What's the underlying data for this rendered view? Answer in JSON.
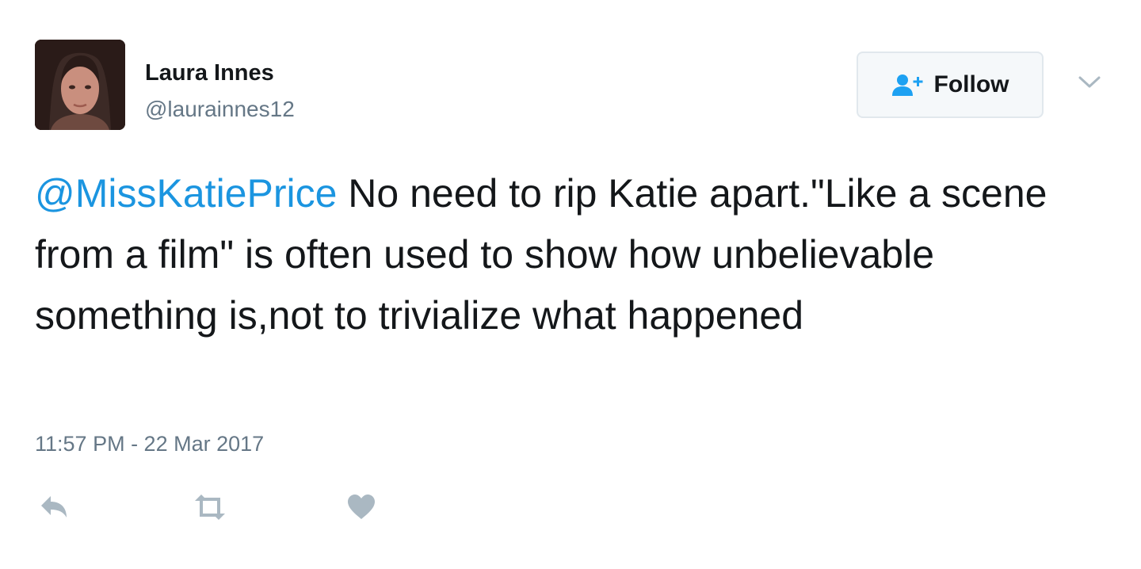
{
  "user": {
    "display_name": "Laura Innes",
    "handle": "@laurainnes12",
    "avatar_icon": "profile-photo"
  },
  "follow_button": {
    "label": "Follow",
    "icon": "add-user-icon"
  },
  "menu": {
    "icon": "chevron-down-icon"
  },
  "tweet": {
    "mention": "@MissKatiePrice",
    "text": " No need to rip Katie apart.\"Like a scene from a film\" is often used to show how unbelievable something is,not to trivialize what happened",
    "timestamp": "11:57 PM - 22 Mar 2017"
  },
  "actions": [
    {
      "icon": "reply-icon"
    },
    {
      "icon": "retweet-icon"
    },
    {
      "icon": "like-icon"
    }
  ],
  "colors": {
    "link": "#1b95e0",
    "secondary_text": "#657786",
    "icon_gray": "#aab8c2",
    "follow_icon": "#1da1f2"
  }
}
